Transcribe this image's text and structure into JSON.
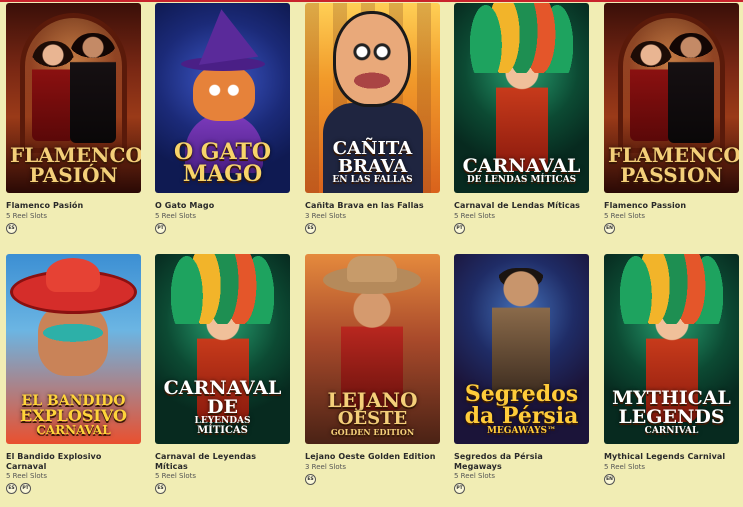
{
  "games": [
    {
      "title": "Flamenco Pasión",
      "type": "5 Reel Slots",
      "langs": [
        "ES"
      ],
      "art": "flamenco",
      "logo": [
        "FLAMENCO",
        "PASIÓN"
      ],
      "logo_color": "#f4cf79"
    },
    {
      "title": "O Gato Mago",
      "type": "5 Reel Slots",
      "langs": [
        "PT"
      ],
      "art": "gato",
      "logo": [
        "O GATO",
        "MAGO"
      ],
      "logo_color": "#f7d46a"
    },
    {
      "title": "Cañita Brava en las Fallas",
      "type": "3 Reel Slots",
      "langs": [
        "ES"
      ],
      "art": "canita",
      "logo": [
        "CAÑITA",
        "BRAVA",
        "EN LAS FALLAS"
      ],
      "logo_color": "#ffffff"
    },
    {
      "title": "Carnaval de Lendas Míticas",
      "type": "5 Reel Slots",
      "langs": [
        "PT"
      ],
      "art": "carnaval",
      "logo": [
        "CARNAVAL",
        "DE LENDAS MÍTICAS"
      ],
      "logo_color": "#ffffff"
    },
    {
      "title": "Flamenco Passion",
      "type": "5 Reel Slots",
      "langs": [
        "EN"
      ],
      "art": "flamenco",
      "logo": [
        "FLAMENCO",
        "PASSION"
      ],
      "logo_color": "#f4cf79"
    },
    {
      "title": "El Bandido Explosivo Carnaval",
      "type": "5 Reel Slots",
      "langs": [
        "ES",
        "PT"
      ],
      "art": "bandido",
      "logo": [
        "EL BANDIDO",
        "EXPLOSIVO",
        "CARNAVAL"
      ],
      "logo_color": "#ffd43a"
    },
    {
      "title": "Carnaval de Leyendas Míticas",
      "type": "5 Reel Slots",
      "langs": [
        "ES"
      ],
      "art": "carnaval",
      "logo": [
        "CARNAVAL DE",
        "LEYENDAS",
        "MÍTICAS"
      ],
      "logo_color": "#ffffff"
    },
    {
      "title": "Lejano Oeste Golden Edition",
      "type": "3 Reel Slots",
      "langs": [
        "ES"
      ],
      "art": "oeste",
      "logo": [
        "LEJANO",
        "OESTE",
        "GOLDEN EDITION"
      ],
      "logo_color": "#f4cf79"
    },
    {
      "title": "Segredos da Pérsia Megaways",
      "type": "5 Reel Slots",
      "langs": [
        "PT"
      ],
      "art": "persia",
      "logo": [
        "Segredos",
        "da Pérsia",
        "MEGAWAYS™"
      ],
      "logo_color": "#ffcc3a"
    },
    {
      "title": "Mythical Legends Carnival",
      "type": "5 Reel Slots",
      "langs": [
        "EN"
      ],
      "art": "carnaval",
      "logo": [
        "MYTHICAL LEGENDS",
        "CARNIVAL"
      ],
      "logo_color": "#ffffff"
    }
  ]
}
